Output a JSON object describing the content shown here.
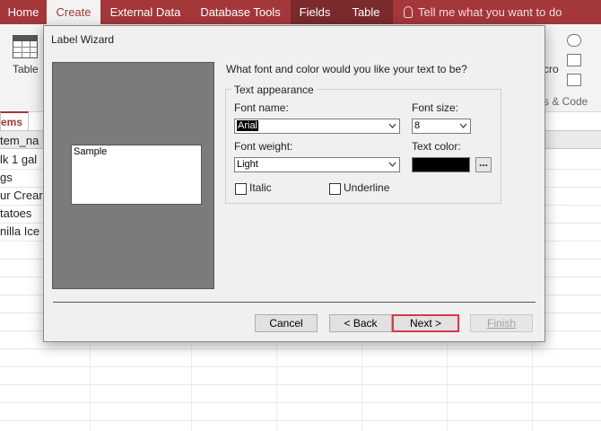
{
  "ribbon": {
    "tabs": [
      "Home",
      "Create",
      "External Data",
      "Database Tools",
      "Fields",
      "Table"
    ],
    "active_tab": "Create",
    "tell_me": "Tell me what you want to do",
    "table_button": "Table",
    "macro_partial": "cro",
    "code_partial": "s & Code"
  },
  "datasheet": {
    "tab_label": "ems",
    "column_header": "tem_na",
    "rows": [
      "lk 1 gal",
      "gs",
      "ur Crear",
      "tatoes",
      "nilla Ice"
    ]
  },
  "dialog": {
    "title": "Label Wizard",
    "sample_text": "Sample",
    "question": "What font and color would you like your text to be?",
    "group_title": "Text appearance",
    "font_name_label": "Font name:",
    "font_name_value": "Arial",
    "font_size_label": "Font size:",
    "font_size_value": "8",
    "font_weight_label": "Font weight:",
    "font_weight_value": "Light",
    "text_color_label": "Text color:",
    "text_color_value": "#000000",
    "ellipsis_button": "...",
    "italic_label": "Italic",
    "italic_checked": false,
    "underline_label": "Underline",
    "underline_checked": false,
    "buttons": {
      "cancel": "Cancel",
      "back": "< Back",
      "next": "Next >",
      "finish": "Finish"
    }
  },
  "colors": {
    "ribbon_accent": "#a4373a",
    "dialog_bg": "#f0f0f0",
    "preview_bg": "#7b7b7b",
    "focus_border": "#d83a4a"
  }
}
